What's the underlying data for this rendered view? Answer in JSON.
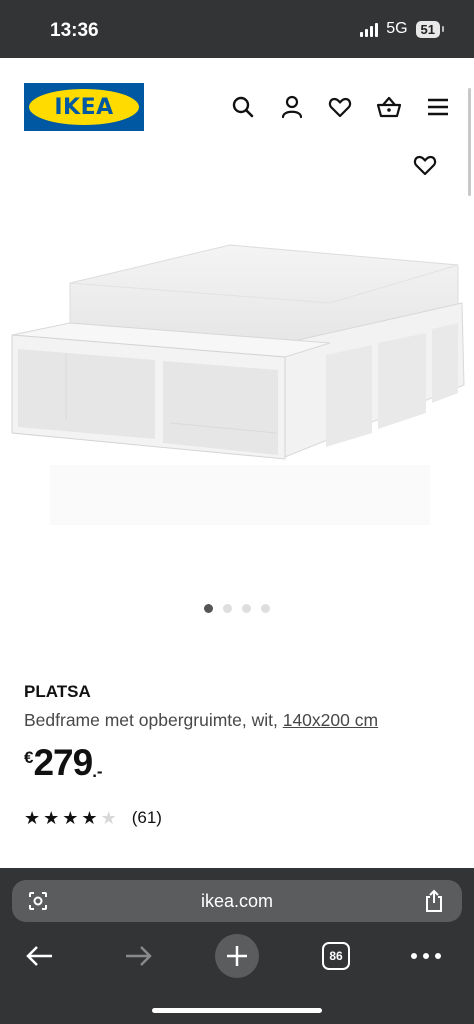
{
  "status_bar": {
    "time": "13:36",
    "network": "5G",
    "battery": "51"
  },
  "header": {
    "logo_text": "IKEA",
    "icons": [
      "search-icon",
      "profile-icon",
      "heart-icon",
      "basket-icon",
      "menu-icon"
    ]
  },
  "gallery": {
    "image_count": 4,
    "active_index": 0
  },
  "product": {
    "name": "PLATSA",
    "description": "Bedframe met opbergruimte, wit, ",
    "size_link": "140x200 cm",
    "price_currency": "€",
    "price_amount": "279",
    "price_suffix": ".-",
    "rating_value": 4,
    "rating_max": 5,
    "review_count": "(61)"
  },
  "browser": {
    "url": "ikea.com",
    "tabs_count": "86"
  },
  "colors": {
    "ikea_blue": "#0058a3",
    "ikea_yellow": "#ffdb00",
    "browser_bg": "#333436"
  }
}
